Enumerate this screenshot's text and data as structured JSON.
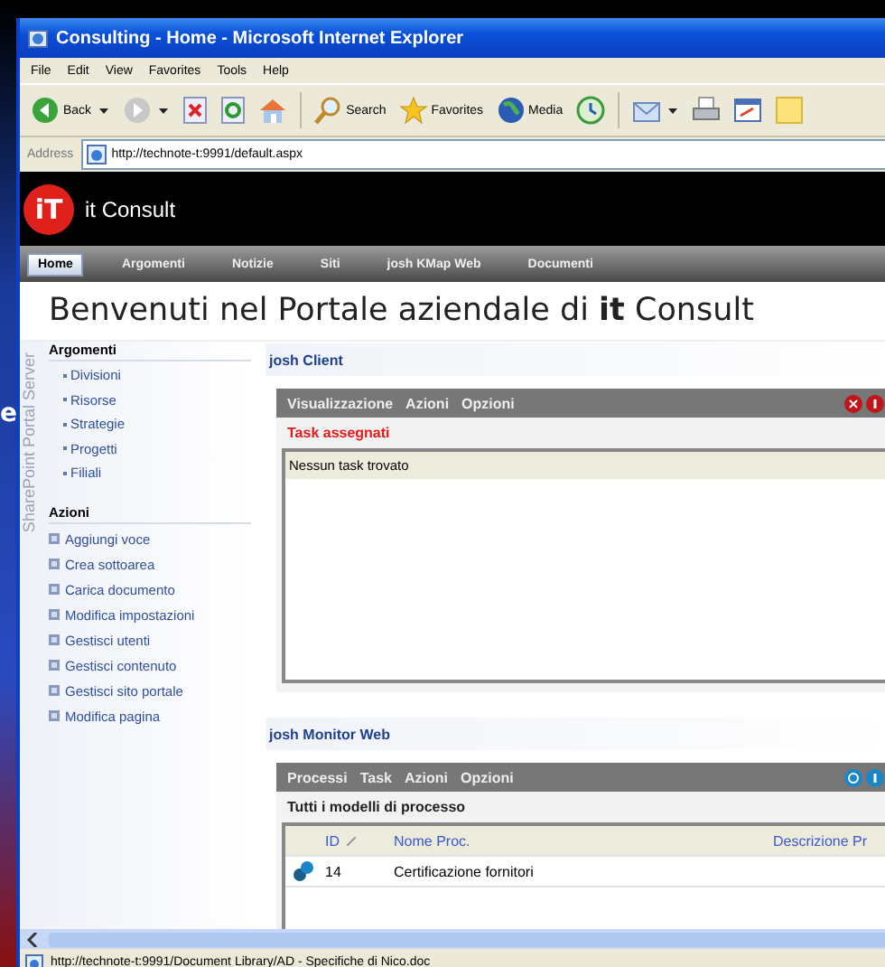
{
  "background_text": "e",
  "window": {
    "title": "Consulting - Home - Microsoft Internet Explorer"
  },
  "menu": [
    "File",
    "Edit",
    "View",
    "Favorites",
    "Tools",
    "Help"
  ],
  "toolbar": [
    {
      "kind": "back",
      "label": "Back",
      "dropdown": true
    },
    {
      "kind": "forward",
      "dropdown": true
    },
    {
      "kind": "stop",
      "dropdown": false
    },
    {
      "kind": "refresh",
      "dropdown": false
    },
    {
      "kind": "home",
      "dropdown": false
    },
    {
      "kind": "search",
      "label": "Search",
      "dropdown": false
    },
    {
      "kind": "favorites",
      "label": "Favorites",
      "dropdown": false
    },
    {
      "kind": "media",
      "label": "Media",
      "dropdown": false
    },
    {
      "kind": "history",
      "dropdown": false
    },
    {
      "kind": "mail",
      "dropdown": true
    },
    {
      "kind": "print",
      "dropdown": false
    },
    {
      "kind": "edit",
      "dropdown": false
    },
    {
      "kind": "note",
      "dropdown": false
    }
  ],
  "address": {
    "label": "Address",
    "value": "http://technote-t:9991/default.aspx"
  },
  "portal": {
    "logo_text": "iT",
    "brand": "it Consult",
    "nav": [
      {
        "label": "Home",
        "selected": true
      },
      {
        "label": "Argomenti",
        "selected": false
      },
      {
        "label": "Notizie",
        "selected": false
      },
      {
        "label": "Siti",
        "selected": false
      },
      {
        "label": "josh KMap Web",
        "selected": false
      },
      {
        "label": "Documenti",
        "selected": false
      }
    ],
    "heading": "Benvenuti nel Portale aziendale di **it** Consult",
    "side_watermark": "SharePoint Portal Server",
    "sidebar": [
      {
        "title": "Argomenti",
        "kind": "topics",
        "items": [
          "Divisioni",
          "Risorse",
          "Strategie",
          "Progetti",
          "Filiali"
        ]
      },
      {
        "title": "Azioni",
        "kind": "actions",
        "items": [
          "Aggiungi voce",
          "Crea sottoarea",
          "Carica documento",
          "Modifica impostazioni",
          "Gestisci utenti",
          "Gestisci contenuto",
          "Gestisci sito portale",
          "Modifica pagina"
        ]
      }
    ],
    "client": {
      "title": "josh Client",
      "menu": [
        "Visualizzazione",
        "Azioni",
        "Opzioni"
      ],
      "subtitle": "Task assegnati",
      "empty": "Nessun task trovato"
    },
    "monitor": {
      "title": "josh Monitor Web",
      "menu": [
        "Processi",
        "Task",
        "Azioni",
        "Opzioni"
      ],
      "subtitle": "Tutti i modelli di processo",
      "columns": [
        "ID",
        "Nome Proc.",
        "Descrizione Pr"
      ],
      "rows": [
        [
          "14",
          "Certificazione fornitori"
        ]
      ]
    }
  },
  "status_bar": {
    "text": "http://technote-t:9991/Document Library/AD - Specifiche di Nico.doc"
  }
}
